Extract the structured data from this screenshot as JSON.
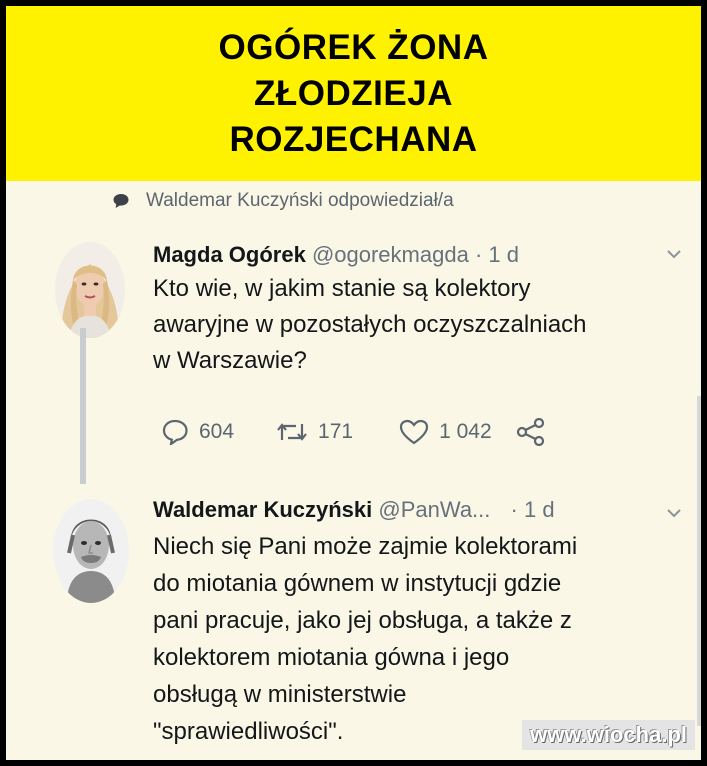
{
  "banner": {
    "line1": "OGÓREK ŻONA",
    "line2": "ZŁODZIEJA",
    "line3": "ROZJECHANA"
  },
  "reply_note": {
    "icon": "comment-icon",
    "text": "Waldemar Kuczyński odpowiedział/a"
  },
  "tweets": [
    {
      "name": "Magda Ogórek",
      "handle": "@ogorekmagda",
      "dot": "·",
      "time": "1 d",
      "lines": [
        "Kto wie, w jakim stanie są kolektory",
        "awaryjne w pozostałych oczyszczalniach",
        "w Warszawie?"
      ],
      "replies": "604",
      "retweets": "171",
      "likes": "1 042"
    },
    {
      "name": "Waldemar Kuczyński",
      "handle": "@PanWa...",
      "dot": "·",
      "time": "1 d",
      "lines": [
        "Niech się Pani może zajmie kolektorami",
        "do miotania gównem w instytucji gdzie",
        "pani pracuje, jako jej obsługa, a także z",
        "kolektorem miotania gówna i jego",
        "obsługą w ministerstwie",
        "\"sprawiedliwości\"."
      ]
    }
  ],
  "watermark": "www.wiocha.pl",
  "colors": {
    "banner_bg": "#fff200",
    "paper_bg": "#faf7e6",
    "text": "#14171a",
    "muted": "#66717b"
  }
}
